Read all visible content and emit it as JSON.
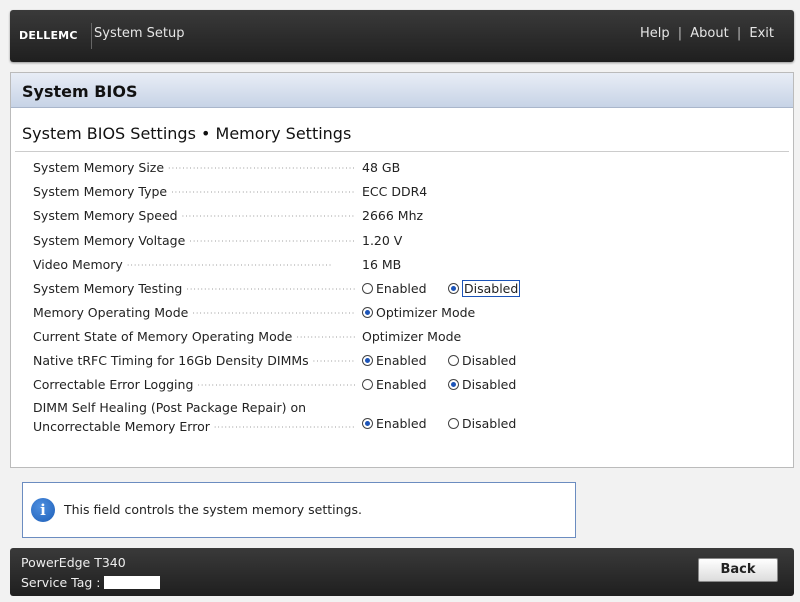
{
  "header": {
    "logo": "DELLEMC",
    "app_title": "System Setup",
    "links": {
      "help": "Help",
      "about": "About",
      "exit": "Exit",
      "separator": "|"
    }
  },
  "panel": {
    "title": "System BIOS",
    "subtitle": "System BIOS Settings • Memory Settings"
  },
  "settings": {
    "memory_size": {
      "label": "System Memory Size",
      "value": "48 GB"
    },
    "memory_type": {
      "label": "System Memory Type",
      "value": "ECC DDR4"
    },
    "memory_speed": {
      "label": "System Memory Speed",
      "value": "2666 Mhz"
    },
    "memory_voltage": {
      "label": "System Memory Voltage",
      "value": "1.20 V"
    },
    "video_memory": {
      "label": "Video Memory",
      "value": "16 MB"
    },
    "memory_testing": {
      "label": "System Memory Testing",
      "options": [
        "Enabled",
        "Disabled"
      ],
      "selected": "Disabled"
    },
    "operating_mode": {
      "label": "Memory Operating Mode",
      "options": [
        "Optimizer Mode"
      ],
      "selected": "Optimizer Mode"
    },
    "current_mode": {
      "label": "Current State of Memory Operating Mode",
      "value": "Optimizer Mode"
    },
    "trfc_timing": {
      "label": "Native tRFC Timing for 16Gb Density DIMMs",
      "options": [
        "Enabled",
        "Disabled"
      ],
      "selected": "Enabled"
    },
    "error_logging": {
      "label": "Correctable Error Logging",
      "options": [
        "Enabled",
        "Disabled"
      ],
      "selected": "Disabled"
    },
    "self_healing": {
      "label_line1": "DIMM Self Healing (Post Package Repair) on",
      "label_line2": "Uncorrectable Memory Error",
      "options": [
        "Enabled",
        "Disabled"
      ],
      "selected": "Enabled"
    }
  },
  "help": {
    "text": "This field controls the system memory settings."
  },
  "footer": {
    "model": "PowerEdge T340",
    "service_tag_label": "Service Tag :",
    "back_label": "Back"
  },
  "colors": {
    "accent": "#1c54b8",
    "header_bg": "#2a2a2a",
    "panel_header": "#c7d3e6"
  }
}
